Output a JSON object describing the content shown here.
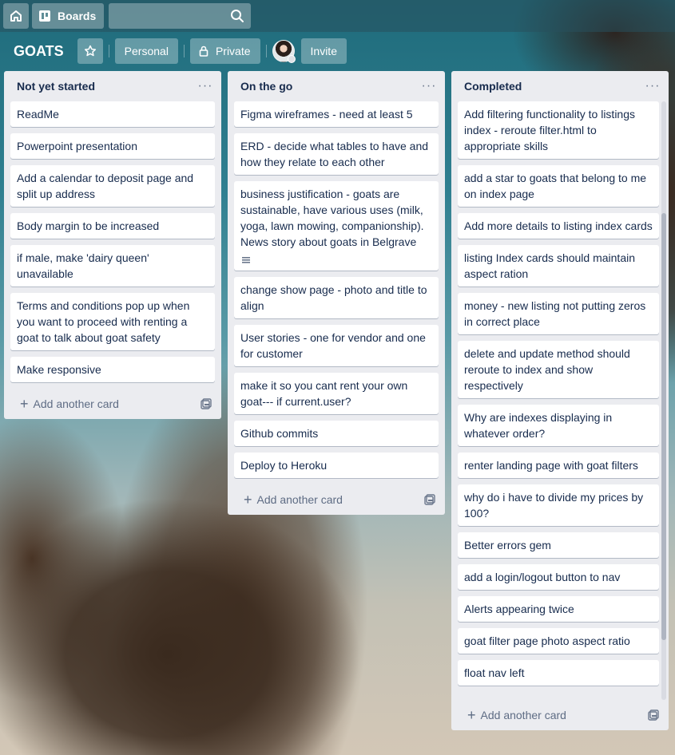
{
  "topbar": {
    "home_icon": "home-icon",
    "boards_label": "Boards",
    "search_value": "",
    "search_placeholder": ""
  },
  "board": {
    "title": "GOATS",
    "personal_label": "Personal",
    "private_label": "Private",
    "invite_label": "Invite"
  },
  "lists": [
    {
      "title": "Not yet started",
      "cards": [
        "ReadMe",
        "Powerpoint presentation",
        "Add a calendar to deposit page and split up address",
        "Body margin to be increased",
        "if male, make 'dairy queen' unavailable",
        "Terms and conditions pop up when you want to proceed with renting a goat to talk about goat safety",
        "Make responsive"
      ],
      "add_label": "Add another card"
    },
    {
      "title": "On the go",
      "cards": [
        "Figma wireframes - need at least 5",
        "ERD - decide what tables to have and how they relate to each other",
        "business justification - goats are sustainable, have various uses (milk, yoga, lawn mowing, companionship). News story about goats in Belgrave",
        "change show page - photo and title to align",
        "User stories - one for vendor and one for customer",
        "make it so you cant rent your own goat--- if current.user?",
        "Github commits",
        "Deploy to Heroku"
      ],
      "add_label": "Add another card"
    },
    {
      "title": "Completed",
      "cards": [
        "Add filtering functionality to listings index - reroute filter.html to appropriate skills",
        "add a star to goats that belong to me on index page",
        "Add more details to listing index cards",
        "listing Index cards should maintain aspect ration",
        "money - new listing not putting zeros in correct place",
        "delete and update method should reroute to index and show respectively",
        "Why are indexes displaying in whatever order?",
        "renter landing page with goat filters",
        "why do i have to divide my prices by 100?",
        "Better errors gem",
        "add a login/logout button to nav",
        "Alerts appearing twice",
        "goat filter page photo aspect ratio",
        "float nav left"
      ],
      "add_label": "Add another card"
    }
  ]
}
